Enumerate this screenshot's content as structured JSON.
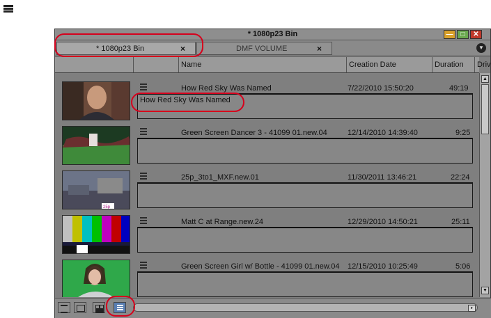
{
  "window": {
    "title": "* 1080p23 Bin",
    "buttons": {
      "minimize": "—",
      "maximize": "□",
      "close": "✕"
    }
  },
  "tabs": [
    {
      "label": "* 1080p23 Bin",
      "close": "×",
      "active": true
    },
    {
      "label": "DMF VOLUME",
      "close": "×",
      "active": false
    }
  ],
  "tab_menu_glyph": "▼",
  "columns": [
    "Name",
    "Creation Date",
    "Duration",
    "Drive"
  ],
  "clips": [
    {
      "name": "How Red Sky Was Named",
      "date": "7/22/2010 15:50:20",
      "duration": "49:19",
      "note": "How Red Sky Was Named",
      "thumb": "man-portrait"
    },
    {
      "name": "Green Screen Dancer 3 - 41099 01.new.04",
      "date": "12/14/2010 14:39:40",
      "duration": "9:25",
      "note": "",
      "thumb": "green-screen-dancer"
    },
    {
      "name": "25p_3to1_MXF.new.01",
      "date": "11/30/2011 13:46:21",
      "duration": "22:24",
      "note": "",
      "thumb": "city-scene",
      "thumb_text": "25p"
    },
    {
      "name": "Matt C at Range.new.24",
      "date": "12/29/2010 14:50:21",
      "duration": "25:11",
      "note": "",
      "thumb": "color-bars"
    },
    {
      "name": "Green Screen Girl w/ Bottle - 41099 01.new.04",
      "date": "12/15/2010 10:25:49",
      "duration": "5:06",
      "note": "",
      "thumb": "green-screen-woman"
    }
  ],
  "scroll": {
    "up": "▲",
    "down": "▼",
    "right": "▸"
  },
  "view_buttons": [
    "brief-view",
    "text-view",
    "frame-view",
    "script-view"
  ],
  "active_view": "script-view",
  "colors": {
    "accent": "#5a7fb2",
    "highlight": "#d6001c",
    "panel": "#7f7f7f"
  }
}
